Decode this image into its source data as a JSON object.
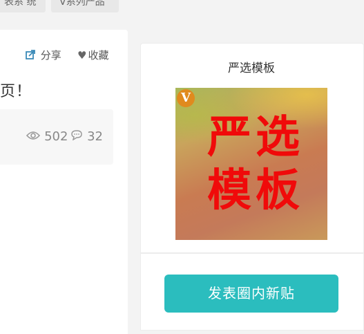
{
  "tags": [
    "表系 统",
    "V系列产品"
  ],
  "topic_actions": {
    "share_label": "分享",
    "favorite_label": "收藏"
  },
  "topic_title_fragment": "页！",
  "topic_stats": {
    "views": "502",
    "comments": "32"
  },
  "template_card": {
    "title": "严选模板",
    "image_text": [
      "严",
      "选",
      "模",
      "板"
    ],
    "badge": "V"
  },
  "post_button_label": "发表圈内新贴",
  "colors": {
    "accent": "#2bbdbe",
    "glyph_red": "#f00a0a",
    "badge_orange": "#e08a1e",
    "share_blue": "#3a8ab8"
  },
  "icons": [
    "share-icon",
    "heart-icon",
    "eye-icon",
    "comment-icon"
  ]
}
